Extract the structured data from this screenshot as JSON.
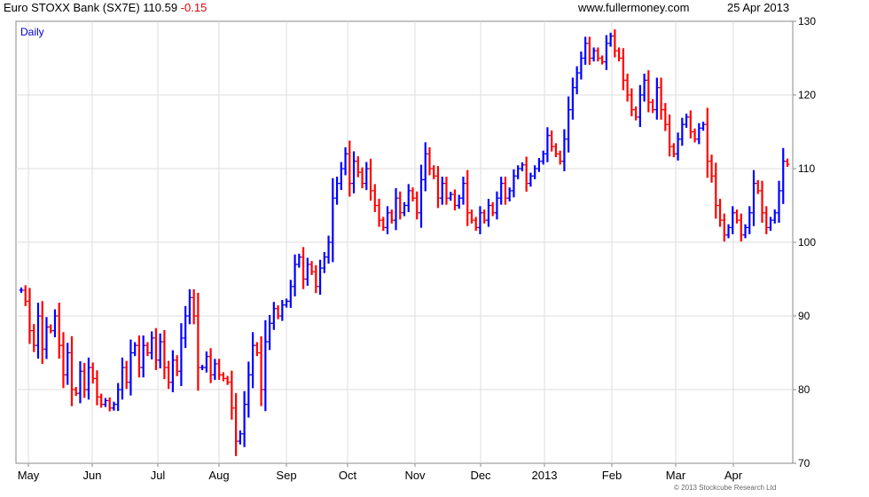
{
  "header": {
    "title": "Euro STOXX Bank (SX7E) 110.59",
    "change": "-0.15",
    "site": "www.fullermoney.com",
    "date": "25 Apr 2013"
  },
  "footer": {
    "copyright": "© 2013 Stockcube Research Ltd"
  },
  "colors": {
    "up": "#0000ff",
    "down": "#ff0000",
    "grid": "#dddddd",
    "frame": "#888888",
    "period_label": "#0000cc"
  },
  "chart_data": {
    "type": "bar",
    "style": "ohlc-daily-price-bars",
    "period_label": "Daily",
    "x_ticks": [
      "May",
      "Jun",
      "Jul",
      "Aug",
      "Sep",
      "Oct",
      "Nov",
      "Dec",
      "2013",
      "Feb",
      "Mar",
      "Apr"
    ],
    "y_ticks": [
      70,
      80,
      90,
      100,
      110,
      120,
      130
    ],
    "ylim": [
      70,
      130
    ],
    "y_axis_side": "right",
    "grid": true,
    "closes": [
      93.5,
      92.0,
      88.0,
      86.0,
      90.0,
      85.5,
      88.5,
      88.0,
      90.0,
      86.0,
      82.0,
      85.0,
      80.0,
      79.5,
      82.5,
      80.0,
      83.0,
      81.5,
      79.0,
      78.0,
      78.5,
      77.5,
      78.0,
      80.0,
      83.0,
      81.0,
      85.0,
      86.0,
      83.0,
      86.0,
      85.0,
      87.0,
      84.0,
      86.5,
      83.0,
      81.0,
      84.0,
      82.5,
      87.0,
      90.0,
      92.5,
      90.0,
      83.0,
      83.0,
      84.5,
      82.0,
      83.5,
      82.0,
      81.5,
      81.0,
      77.5,
      73.0,
      74.0,
      78.0,
      82.0,
      86.0,
      85.0,
      80.0,
      86.5,
      89.0,
      91.0,
      90.0,
      91.5,
      92.0,
      94.0,
      97.0,
      98.0,
      95.0,
      97.0,
      96.0,
      94.0,
      96.5,
      98.0,
      100.0,
      106.0,
      108.0,
      110.0,
      112.0,
      108.0,
      111.0,
      109.5,
      108.0,
      110.0,
      107.0,
      105.0,
      103.0,
      102.0,
      104.0,
      103.0,
      106.0,
      104.0,
      105.0,
      107.0,
      106.0,
      104.0,
      108.5,
      112.0,
      110.0,
      109.0,
      106.0,
      108.0,
      106.0,
      106.5,
      105.0,
      106.0,
      108.0,
      104.0,
      103.0,
      102.0,
      104.0,
      103.0,
      105.0,
      104.0,
      106.0,
      108.0,
      106.0,
      107.0,
      109.0,
      110.0,
      110.5,
      108.0,
      109.0,
      110.0,
      111.0,
      112.0,
      114.5,
      113.0,
      112.0,
      111.0,
      114.0,
      118.0,
      121.0,
      123.0,
      125.0,
      127.0,
      125.0,
      126.0,
      125.0,
      124.5,
      127.0,
      128.0,
      126.0,
      125.0,
      122.0,
      120.0,
      118.0,
      117.0,
      120.0,
      122.0,
      119.0,
      118.0,
      121.0,
      118.0,
      116.0,
      113.0,
      112.0,
      114.0,
      116.0,
      117.0,
      115.0,
      114.0,
      115.5,
      116.0,
      111.0,
      109.0,
      105.0,
      103.0,
      101.0,
      102.0,
      104.0,
      103.0,
      101.0,
      102.0,
      104.0,
      108.0,
      107.0,
      104.0,
      102.0,
      103.0,
      104.0,
      107.0,
      111.0,
      110.6
    ]
  }
}
